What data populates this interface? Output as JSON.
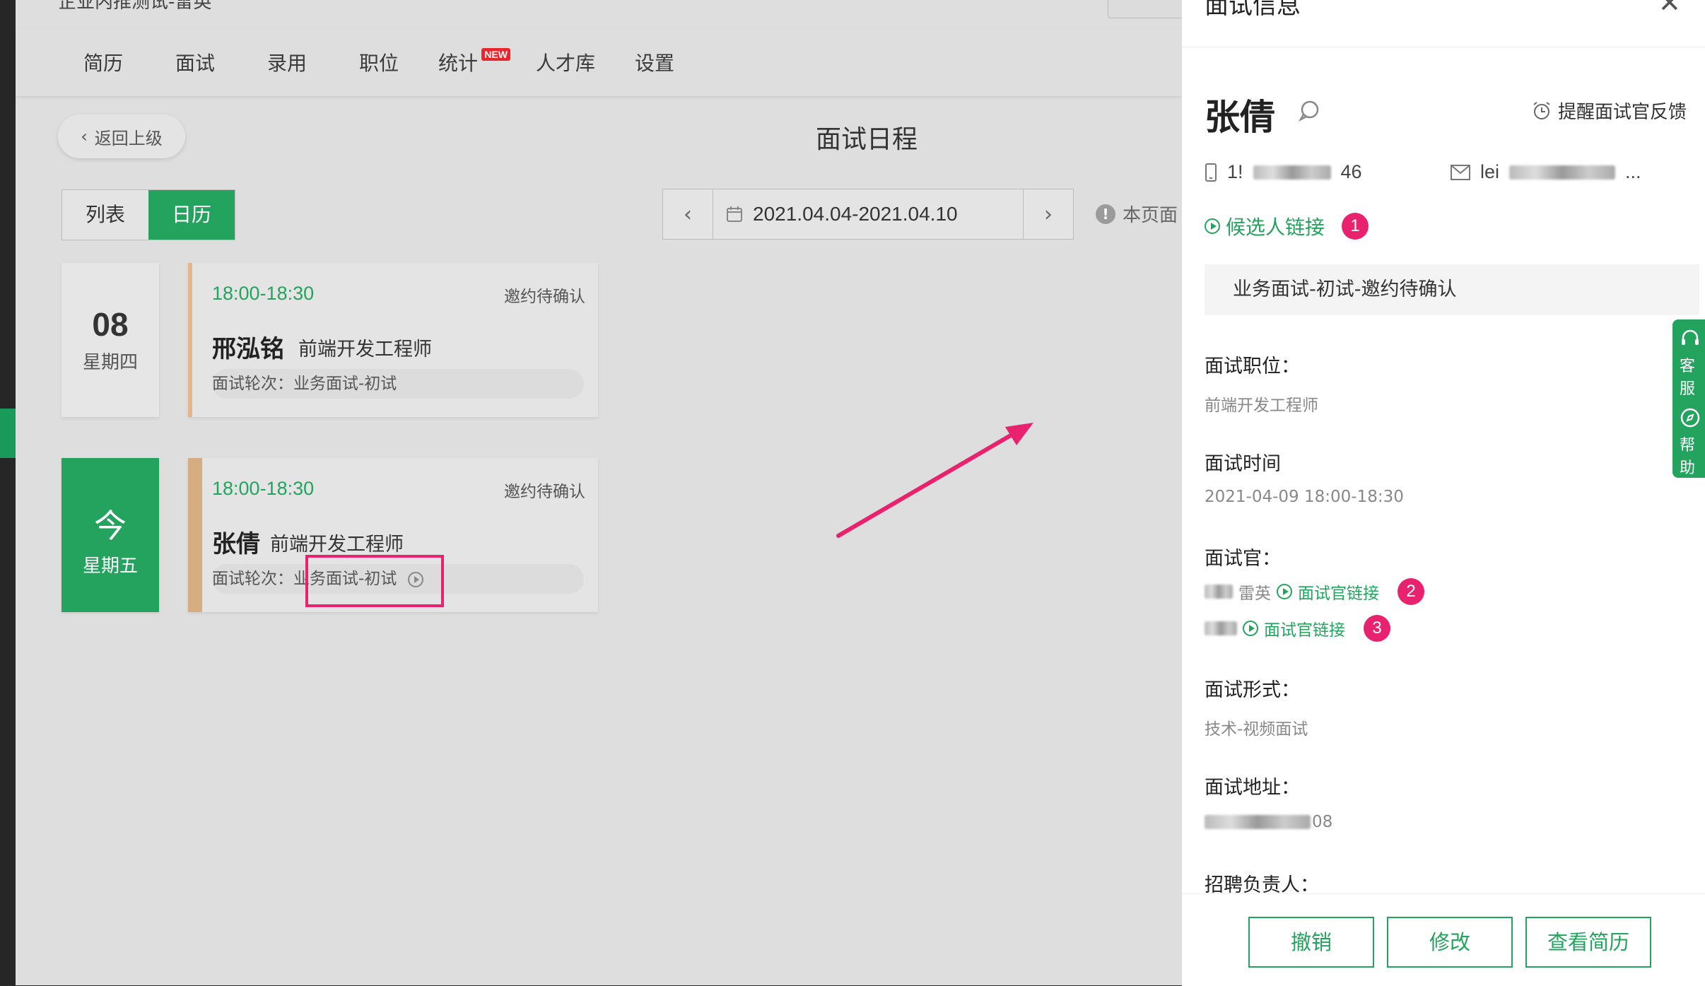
{
  "app": {
    "crumb": "企业内推测试-雷英",
    "nav": [
      {
        "label": "简历"
      },
      {
        "label": "面试"
      },
      {
        "label": "录用"
      },
      {
        "label": "职位"
      },
      {
        "label": "统计",
        "badge": "NEW"
      },
      {
        "label": "人才库"
      },
      {
        "label": "设置"
      }
    ],
    "back_label": "返回上级",
    "page_title": "面试日程",
    "view_toggle": {
      "list": "列表",
      "calendar": "日历",
      "active": "calendar"
    },
    "date_range": "2021.04.04-2021.04.10",
    "page_note": "本页面",
    "days": [
      {
        "day": "08",
        "weekday": "星期四",
        "is_today": false,
        "event": {
          "time": "18:00-18:30",
          "status": "邀约待确认",
          "name": "邢泓铭",
          "position": "前端开发工程师",
          "round_label": "面试轮次：",
          "round": "业务面试-初试"
        }
      },
      {
        "day": "今",
        "weekday": "星期五",
        "is_today": true,
        "event": {
          "time": "18:00-18:30",
          "status": "邀约待确认",
          "name": "张倩",
          "position": "前端开发工程师",
          "round_label": "面试轮次：",
          "round": "业务面试-初试"
        }
      }
    ]
  },
  "panel": {
    "title": "面试信息",
    "candidate_name": "张倩",
    "remind_label": "提醒面试官反馈",
    "phone": {
      "prefix": "1!",
      "suffix": "46"
    },
    "email": {
      "prefix": "lei",
      "suffix": "..."
    },
    "candidate_link": "候选人链接",
    "stage": "业务面试-初试-邀约待确认",
    "fields": {
      "position_label": "面试职位：",
      "position_value": "前端开发工程师",
      "time_label": "面试时间",
      "time_value": "2021-04-09 18:00-18:30",
      "interviewer_label": "面试官：",
      "interviewers": [
        {
          "name": "雷英",
          "link": "面试官链接",
          "badge": "2"
        },
        {
          "name": "",
          "link": "面试官链接",
          "badge": "3"
        }
      ],
      "format_label": "面试形式：",
      "format_value": "技术-视频面试",
      "address_label": "面试地址：",
      "address_suffix": "08",
      "recruiter_label": "招聘负责人："
    },
    "candidate_badge": "1",
    "side_tabs": [
      "客服",
      "帮助"
    ],
    "buttons": {
      "cancel": "撤销",
      "edit": "修改",
      "resume": "查看简历"
    }
  },
  "colors": {
    "accent": "#23a35e",
    "annotation": "#e8226e",
    "event_bar": "#e3b789"
  },
  "icons": [
    "chevron-left-icon",
    "chevron-right-icon",
    "calendar-icon",
    "info-icon",
    "close-icon",
    "chat-icon",
    "alarm-icon",
    "phone-icon",
    "mail-icon",
    "play-circle-icon",
    "headset-icon",
    "compass-icon"
  ]
}
